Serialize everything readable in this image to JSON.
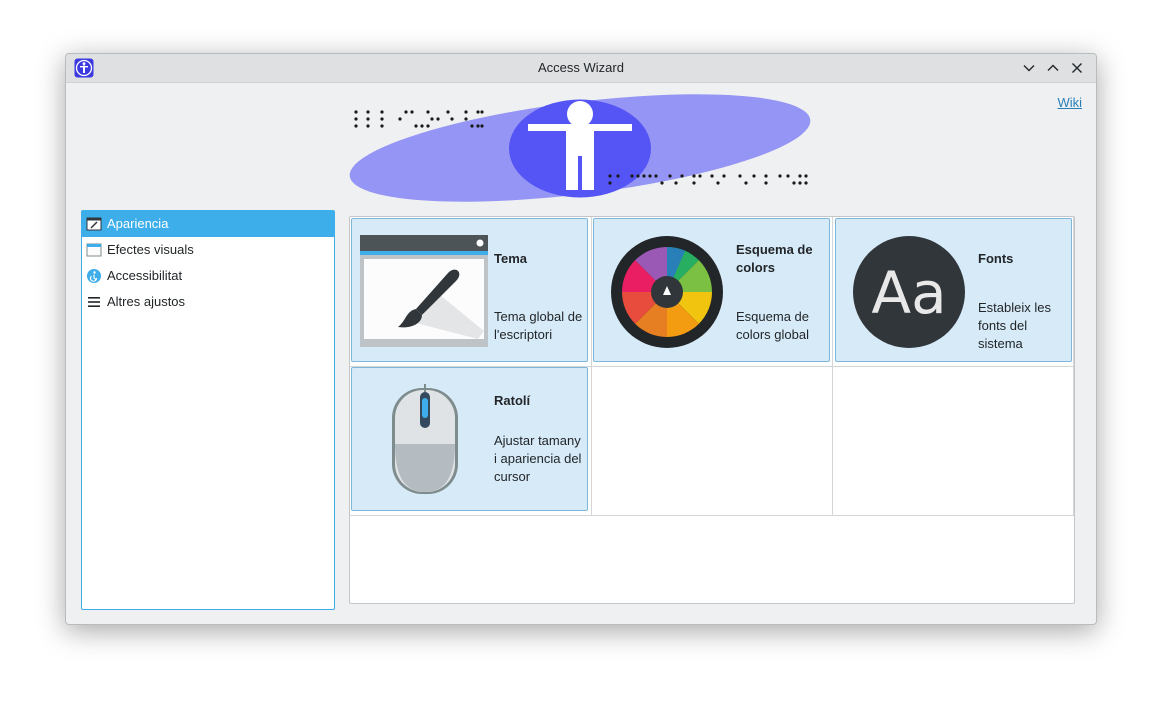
{
  "window": {
    "title": "Access Wizard",
    "controls": [
      "minimize",
      "maximize",
      "close"
    ]
  },
  "header": {
    "wiki_link": "Wiki"
  },
  "sidebar": {
    "items": [
      {
        "label": "Apariencia",
        "icon": "appearance-icon",
        "active": true
      },
      {
        "label": "Efectes visuals",
        "icon": "visual-effects-icon",
        "active": false
      },
      {
        "label": "Accessibilitat",
        "icon": "accessibility-icon",
        "active": false
      },
      {
        "label": "Altres ajustos",
        "icon": "menu-icon",
        "active": false
      }
    ]
  },
  "tiles": [
    {
      "title": "Tema",
      "description": "Tema global de l'escriptori",
      "icon": "theme-brush-icon"
    },
    {
      "title": "Esquema de colors",
      "description": "Esquema de colors global",
      "icon": "color-wheel-icon"
    },
    {
      "title": "Fonts",
      "description": "Estableix les fonts del sistema",
      "icon": "fonts-aa-icon"
    },
    {
      "title": "Ratolí",
      "description": "Ajustar tamany i apariencia del cursor",
      "icon": "mouse-icon"
    }
  ],
  "colors": {
    "accent": "#3daee9",
    "tile_bg": "#d6eaf8",
    "banner_ellipse": "#9595f5",
    "banner_circle": "#5555f5"
  }
}
